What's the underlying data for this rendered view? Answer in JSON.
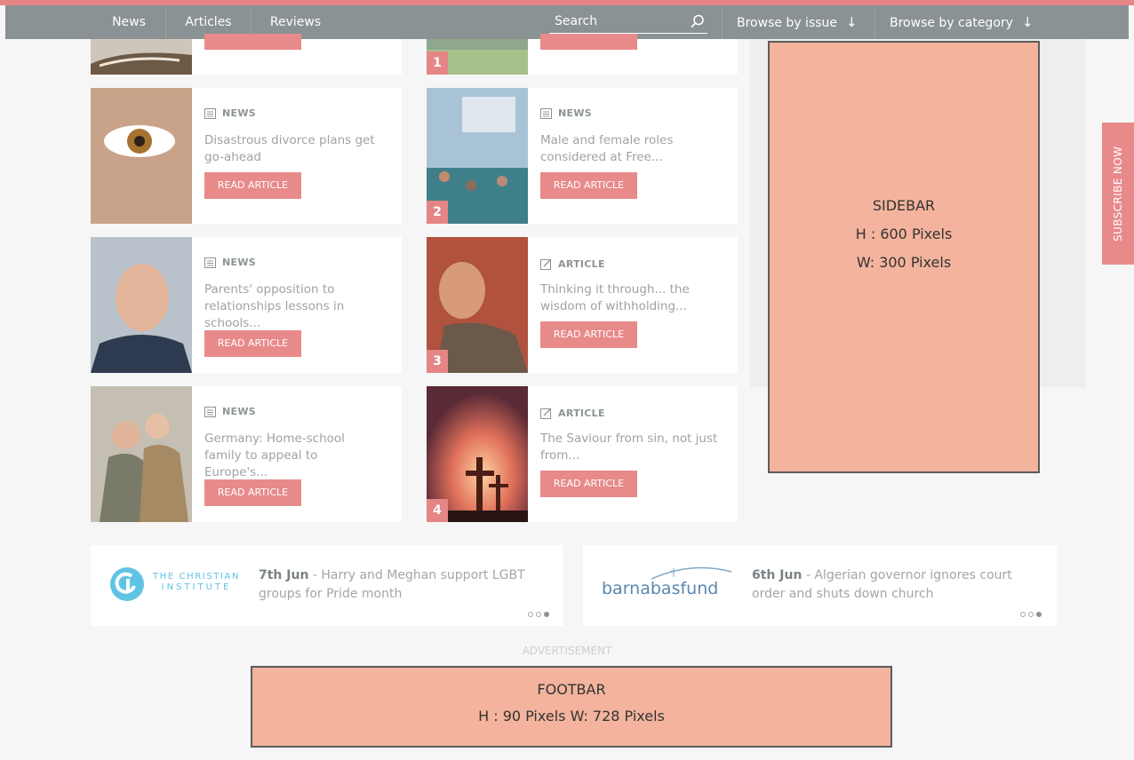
{
  "nav": {
    "items": [
      "News",
      "Articles",
      "Reviews"
    ],
    "search_placeholder": "Search",
    "browse_issue": "Browse by issue",
    "browse_category": "Browse by category",
    "arrow": "↓"
  },
  "top_row": {
    "rank": "1"
  },
  "cards": [
    {
      "tag": "NEWS",
      "title": "Disastrous divorce plans get go-ahead",
      "button": "READ ARTICLE"
    },
    {
      "tag": "NEWS",
      "title": "Male and female roles considered at Free...",
      "button": "READ ARTICLE",
      "rank": "2"
    },
    {
      "tag": "NEWS",
      "title": "Parents' opposition to relationships lessons in schools...",
      "button": "READ ARTICLE"
    },
    {
      "tag": "ARTICLE",
      "title": "Thinking it through... the wisdom of withholding...",
      "button": "READ ARTICLE",
      "rank": "3"
    },
    {
      "tag": "NEWS",
      "title": "Germany: Home-school family to appeal to Europe's...",
      "button": "READ ARTICLE"
    },
    {
      "tag": "ARTICLE",
      "title": "The Saviour from sin, not just from...",
      "button": "READ ARTICLE",
      "rank": "4"
    }
  ],
  "sidebar": {
    "line1": "SIDEBAR",
    "line2": "H : 600 Pixels",
    "line3": "W: 300 Pixels"
  },
  "subscribe": "SUBSCRIBE NOW",
  "partners": [
    {
      "logo_line1": "THE CHRISTIAN",
      "logo_line2": "INSTITUTE",
      "date": "7th Jun",
      "text": " - Harry and Meghan support LGBT groups for Pride month"
    },
    {
      "logo": "barnabasfund",
      "date": "6th Jun",
      "text": " - Algerian governor ignores court order and shuts down church"
    }
  ],
  "advertisement": "ADVERTISEMENT",
  "footbar": {
    "line1": "FOOTBAR",
    "line2": "H : 90 Pixels  W: 728 Pixels"
  },
  "colors": {
    "accent": "#e58585",
    "nav": "#8a9294",
    "placeholder_fill": "#f3b39d"
  },
  "icons": {
    "search": "search-icon",
    "news": "news-icon",
    "article": "edit-icon",
    "down": "arrow-down-icon"
  }
}
